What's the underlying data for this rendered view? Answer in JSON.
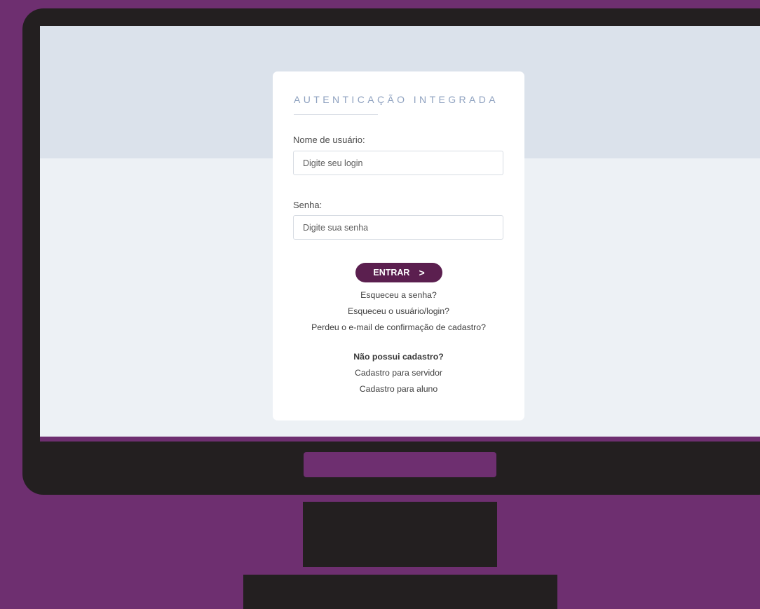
{
  "login": {
    "title": "AUTENTICAÇÃO INTEGRADA",
    "username_label": "Nome de usuário:",
    "username_placeholder": "Digite seu login",
    "password_label": "Senha:",
    "password_placeholder": "Digite sua senha",
    "submit_label": "ENTRAR",
    "submit_icon": "chevron-right-icon",
    "submit_icon_glyph": ">",
    "forgot_password": "Esqueceu a senha?",
    "forgot_username": "Esqueceu o usuário/login?",
    "lost_confirmation_email": "Perdeu o e-mail de confirmação de cadastro?",
    "no_account_heading": "Não possui cadastro?",
    "register_staff": "Cadastro para servidor",
    "register_student": "Cadastro para aluno"
  },
  "colors": {
    "background_purple": "#6e2f70",
    "monitor_black": "#231f20",
    "button_plum": "#5b1f4f",
    "screen_band": "#dbe2eb",
    "screen_body": "#edf1f5",
    "title_text": "#8fa2c0"
  }
}
